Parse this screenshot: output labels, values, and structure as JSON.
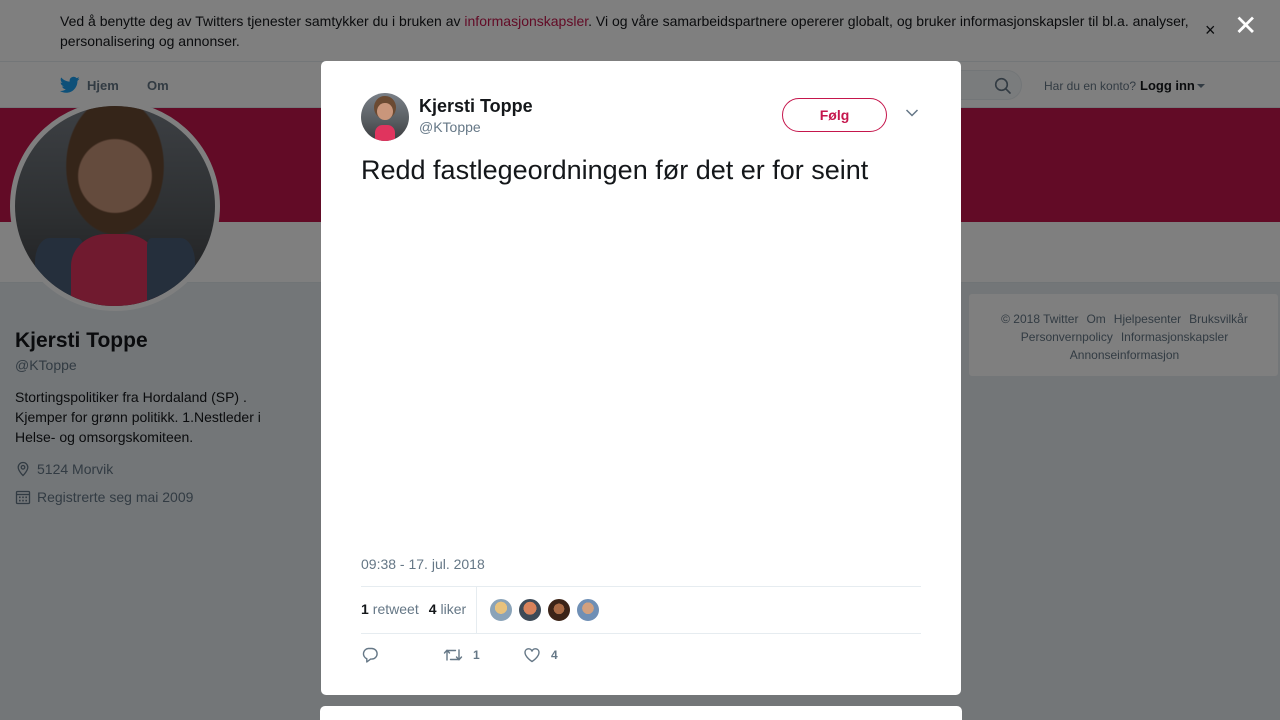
{
  "cookie_banner": {
    "text_before": "Ved å benytte deg av Twitters tjenester samtykker du i bruken av ",
    "link": "informasjonskapsler",
    "text_after": ". Vi og våre samarbeidspartnere opererer globalt, og bruker informasjonskapsler til bl.a. analyser, personalisering og annonser.",
    "close": "×"
  },
  "nav": {
    "home": "Hjem",
    "about": "Om",
    "have_account": "Har du en konto?",
    "login": "Logg inn"
  },
  "profile": {
    "name": "Kjersti Toppe",
    "handle": "@KToppe",
    "bio": "Stortingspolitiker fra Hordaland (SP) . Kjemper for grønn politikk. 1.Nestleder i Helse- og omsorgskomiteen.",
    "location": "5124 Morvik",
    "joined": "Registrerte seg mai 2009"
  },
  "footer": {
    "copyright": "© 2018 Twitter",
    "about": "Om",
    "help": "Hjelpesenter",
    "terms": "Bruksvilkår",
    "privacy": "Personvernpolicy",
    "cookies": "Informasjonskapsler",
    "ads": "Annonseinformasjon"
  },
  "overlay": {
    "close": "✕"
  },
  "tweet": {
    "author_name": "Kjersti Toppe",
    "author_handle": "@KToppe",
    "follow_label": "Følg",
    "text": "Redd fastlegeordningen før det er for seint",
    "timestamp": "09:38 - 17. jul. 2018",
    "retweet_count": "1",
    "retweet_label": "retweet",
    "like_count": "4",
    "like_label": "liker",
    "actions": {
      "reply_count": "",
      "retweet_count": "1",
      "like_count": "4"
    }
  },
  "colors": {
    "accent": "#c5164c",
    "banner": "#c5164c"
  },
  "icons": [
    "twitter-bird-icon",
    "search-icon",
    "location-pin-icon",
    "calendar-icon",
    "chevron-down-icon",
    "reply-icon",
    "retweet-icon",
    "heart-icon",
    "close-icon"
  ]
}
